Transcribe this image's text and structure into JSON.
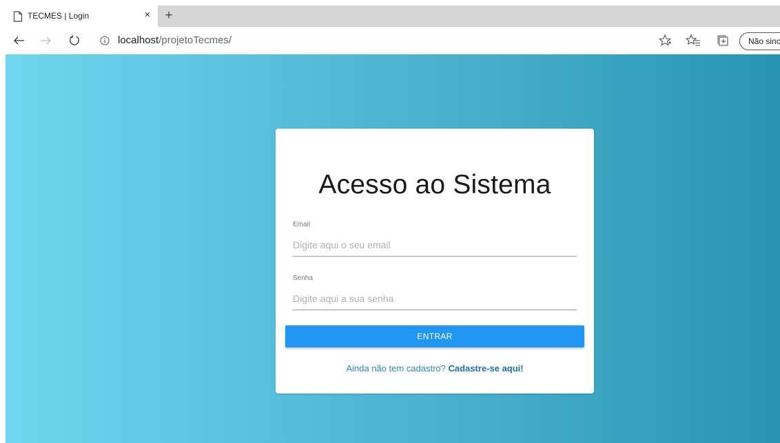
{
  "browser": {
    "tab_title": "TECMES | Login",
    "tab_close": "×",
    "new_tab": "+",
    "url_host": "localhost",
    "url_path": "/projetoTecmes/",
    "sync_label": "Não sincr",
    "icons": {
      "back": "arrow-left-icon",
      "forward": "arrow-right-icon",
      "refresh": "refresh-icon",
      "info": "info-icon",
      "favorite": "star-icon",
      "favorites_list": "favorites-list-icon",
      "collections": "collections-icon"
    }
  },
  "login": {
    "title": "Acesso ao Sistema",
    "email_label": "Email",
    "email_placeholder": "Digite aqui o seu email",
    "password_label": "Senha",
    "password_placeholder": "Digite aqui a sua senha",
    "submit_label": "ENTRAR",
    "signup_prompt": "Ainda não tem cadastro?",
    "signup_link": "Cadastre-se aqui!"
  },
  "colors": {
    "button": "#2196f3",
    "gradient_start": "#6fd6ef",
    "gradient_end": "#2894b2",
    "link": "#2b86c4"
  }
}
